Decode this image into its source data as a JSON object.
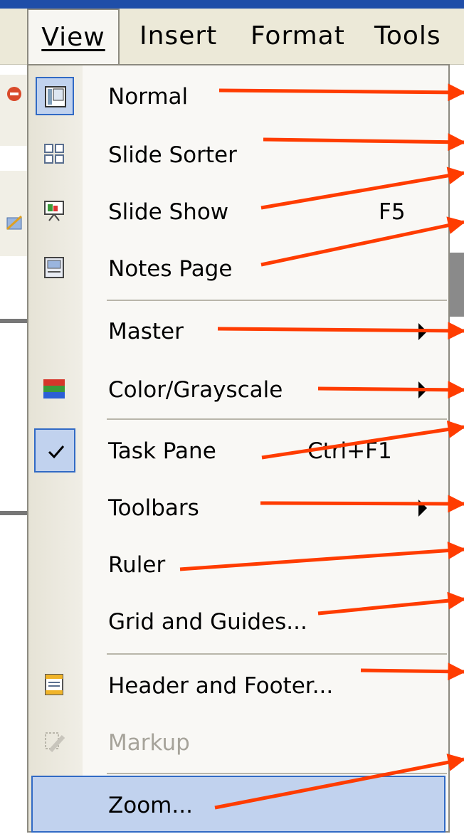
{
  "menubar": {
    "view_label": "View",
    "insert_label": "Insert",
    "format_label": "Format",
    "tools_label": "Tools"
  },
  "menu": {
    "normal": "Normal",
    "slide_sorter": "Slide Sorter",
    "slide_show": "Slide Show",
    "slide_show_shortcut": "F5",
    "notes_page": "Notes Page",
    "master": "Master",
    "color_grayscale": "Color/Grayscale",
    "task_pane": "Task Pane",
    "task_pane_shortcut": "Ctrl+F1",
    "toolbars": "Toolbars",
    "ruler": "Ruler",
    "grid_and_guides": "Grid and Guides...",
    "header_and_footer": "Header and Footer...",
    "markup": "Markup",
    "zoom": "Zoom..."
  },
  "state": {
    "normal_selected": true,
    "task_pane_checked": true,
    "markup_disabled": true,
    "zoom_highlighted": true
  },
  "colors": {
    "arrow": "#ff3c00",
    "highlight": "#c1d2ee",
    "highlight_border": "#316ac5",
    "menubar_bg": "#ece9d8",
    "title_strip": "#1f4ea8"
  },
  "icons": [
    "normal-view-icon",
    "slide-sorter-icon",
    "slide-show-icon",
    "notes-page-icon",
    "color-grayscale-icon",
    "checkmark-icon",
    "header-footer-icon",
    "markup-icon",
    "submenu-arrow-icon"
  ]
}
